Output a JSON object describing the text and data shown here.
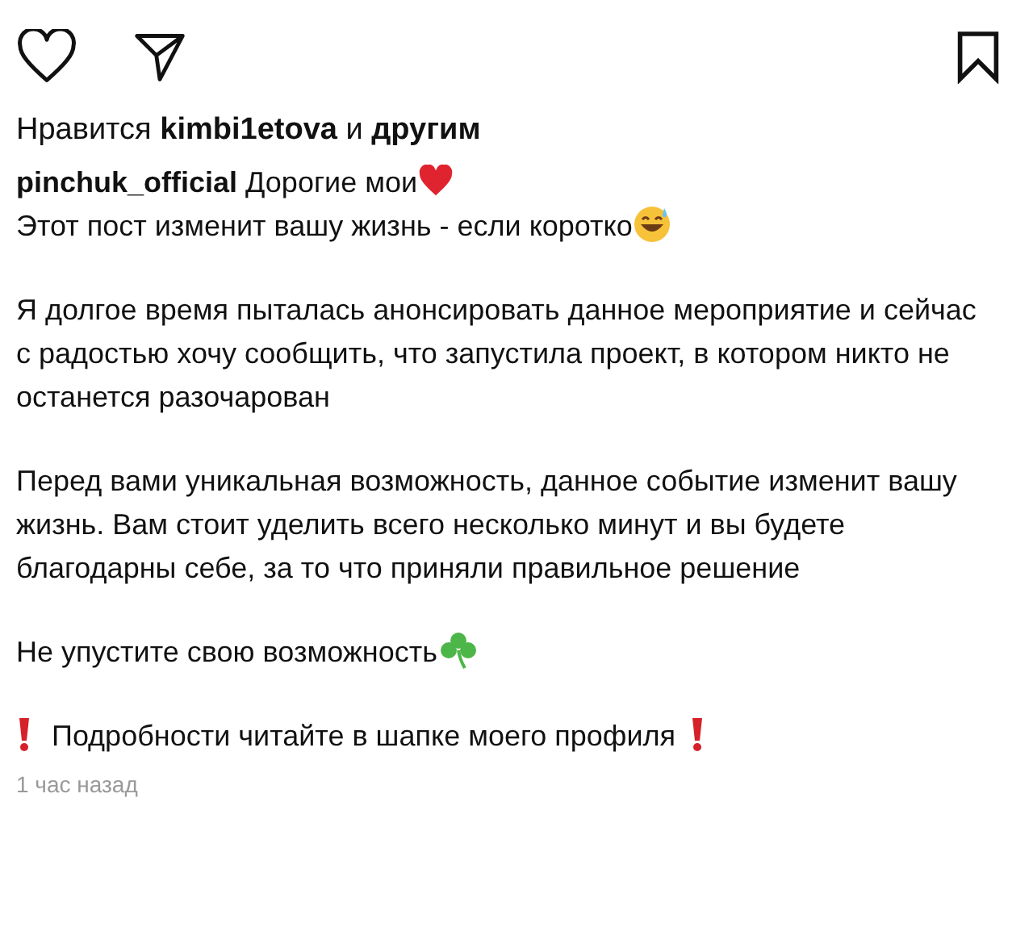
{
  "likes": "Нравится **kimbi1etova** и **другим**",
  "caption": {
    "username": "pinchuk_official",
    "paragraphs": [
      {
        "lines": [
          {
            "text": "Дорогие мои",
            "kind": "heart"
          },
          {
            "text": "Этот пост изменит вашу жизнь - если коротко",
            "kind": "sweat-smile"
          }
        ]
      },
      {
        "lines": [
          {
            "text": "Я долгое время пыталась анонсировать данное мероприятие и сейчас с радостью хочу сообщить, что запустила проект, в котором никто не останется разочарован",
            "kind": "plain"
          }
        ]
      },
      {
        "lines": [
          {
            "text": "Перед вами уникальная возможность, данное событие изменит вашу жизнь. Вам стоит уделить всего несколько минут и вы будете благодарны себе, за то что приняли правильное решение",
            "kind": "plain"
          }
        ]
      },
      {
        "lines": [
          {
            "text": "Не упустите свою возможность",
            "kind": "clover"
          }
        ]
      },
      {
        "lines": [
          {
            "text": "Подробности читайте в шапке моего профиля",
            "kind": "alert"
          }
        ]
      }
    ]
  },
  "time": "1 час назад"
}
